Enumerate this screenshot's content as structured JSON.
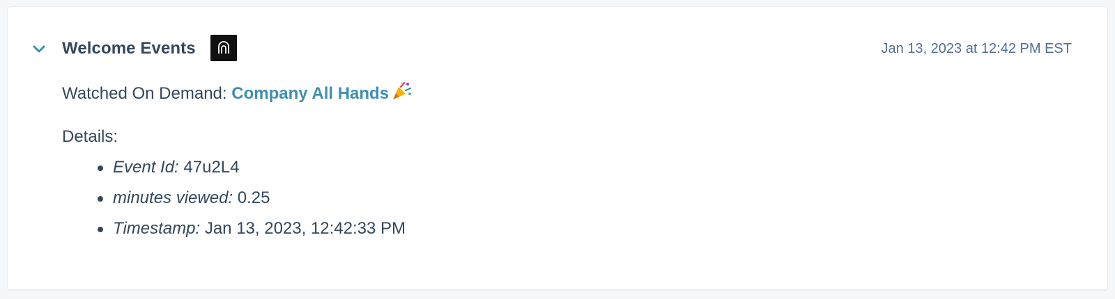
{
  "timeline_event": {
    "title": "Welcome Events",
    "app_logo_icon": "doorway-logo-icon",
    "chevron_icon": "chevron-down-icon",
    "timestamp": "Jan 13, 2023 at 12:42 PM EST",
    "watched": {
      "prefix": "Watched On Demand: ",
      "event_name": "Company All Hands",
      "emoji_icon": "party-popper-icon"
    },
    "details_label": "Details:",
    "details": [
      {
        "key": "Event Id:",
        "value": " 47u2L4"
      },
      {
        "key": "minutes viewed:",
        "value": " 0.25"
      },
      {
        "key": "Timestamp:",
        "value": " Jan 13, 2023, 12:42:33 PM"
      }
    ]
  },
  "colors": {
    "page_background": "#f5f8fa",
    "card_background": "#ffffff",
    "text": "#33475b",
    "muted_text": "#516f90",
    "link": "#3e8fb0",
    "chevron": "#3e8fb0"
  }
}
